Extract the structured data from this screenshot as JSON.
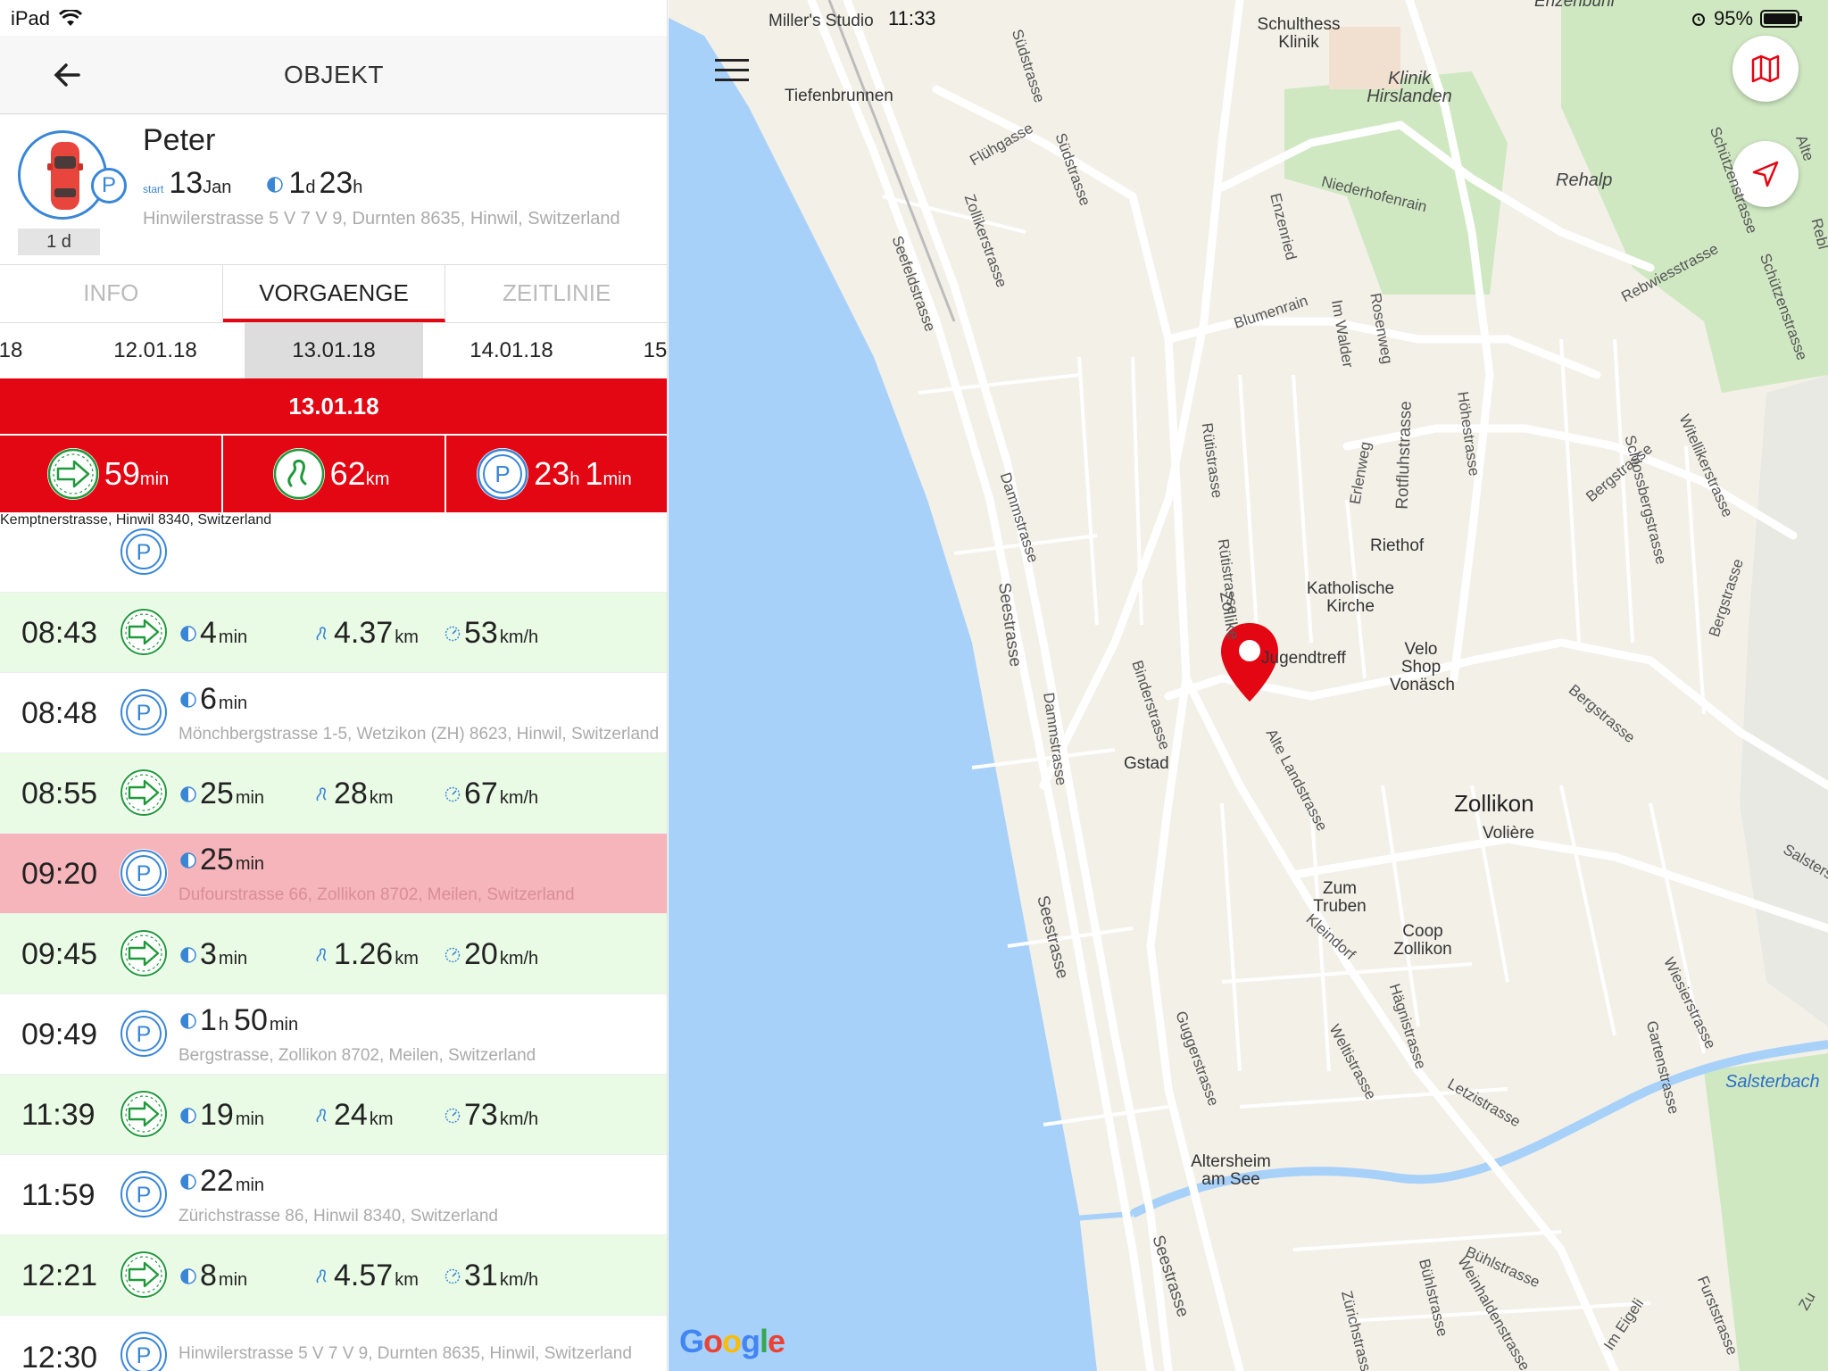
{
  "status_bar": {
    "device": "iPad",
    "time": "11:33",
    "battery": "95%"
  },
  "nav": {
    "title": "OBJEKT"
  },
  "object": {
    "name": "Peter",
    "start_label": "start",
    "start_day": "13",
    "start_month": "Jan",
    "duration_d": "1",
    "duration_d_unit": "d",
    "duration_h": "23",
    "duration_h_unit": "h",
    "address": "Hinwilerstrasse 5 V 7 V 9, Durnten 8635, Hinwil, Switzerland",
    "badge": "1 d"
  },
  "tabs": [
    {
      "label": "INFO"
    },
    {
      "label": "VORGAENGE"
    },
    {
      "label": "ZEITLINIE"
    }
  ],
  "dates": [
    "18",
    "12.01.18",
    "13.01.18",
    "14.01.18",
    "15"
  ],
  "day": {
    "title": "13.01.18",
    "drive_time": "59",
    "drive_time_unit": "min",
    "distance": "62",
    "distance_unit": "km",
    "park_h": "23",
    "park_h_unit": "h",
    "park_min": "1",
    "park_min_unit": "min"
  },
  "timeline": {
    "first": {
      "address": "Kemptnerstrasse, Hinwil 8340, Switzerland"
    },
    "rows": [
      {
        "time": "08:43",
        "dur": "4",
        "dur_unit": "min",
        "dist": "4.37",
        "dist_unit": "km",
        "speed": "53",
        "speed_unit": "km/h"
      },
      {
        "time": "08:48",
        "dur": "6",
        "dur_unit": "min",
        "address": "Mönchbergstrasse 1-5, Wetzikon (ZH) 8623, Hinwil, Switzerland"
      },
      {
        "time": "08:55",
        "dur": "25",
        "dur_unit": "min",
        "dist": "28",
        "dist_unit": "km",
        "speed": "67",
        "speed_unit": "km/h"
      },
      {
        "time": "09:20",
        "dur": "25",
        "dur_unit": "min",
        "address": "Dufourstrasse 66, Zollikon 8702, Meilen, Switzerland"
      },
      {
        "time": "09:45",
        "dur": "3",
        "dur_unit": "min",
        "dist": "1.26",
        "dist_unit": "km",
        "speed": "20",
        "speed_unit": "km/h"
      },
      {
        "time": "09:49",
        "dur_h": "1",
        "dur_h_unit": "h",
        "dur": "50",
        "dur_unit": "min",
        "address": "Bergstrasse, Zollikon 8702, Meilen, Switzerland"
      },
      {
        "time": "11:39",
        "dur": "19",
        "dur_unit": "min",
        "dist": "24",
        "dist_unit": "km",
        "speed": "73",
        "speed_unit": "km/h"
      },
      {
        "time": "11:59",
        "dur": "22",
        "dur_unit": "min",
        "address": "Zürichstrasse 86, Hinwil 8340, Switzerland"
      },
      {
        "time": "12:21",
        "dur": "8",
        "dur_unit": "min",
        "dist": "4.57",
        "dist_unit": "km",
        "speed": "31",
        "speed_unit": "km/h"
      },
      {
        "time": "12:30",
        "address": "Hinwilerstrasse 5 V 7 V 9, Durnten 8635, Hinwil, Switzerland"
      }
    ]
  },
  "map": {
    "labels": {
      "millers": "Miller's Studio",
      "tiefenbrunnen": "Tiefenbrunnen",
      "schulthess": "Schulthess Klinik",
      "hirslanden": "Klinik Hirslanden",
      "rehalp": "Rehalp",
      "enzenbuhl": "Enzenbuhl",
      "riethof": "Riethof",
      "kirche": "Katholische Kirche",
      "jugendtreff": "Jugendtreff",
      "velo": "Velo Shop Vonäsch",
      "gstad": "Gstad",
      "zollikon": "Zollikon",
      "voliere": "Volière",
      "truben": "Zum Truben",
      "coop": "Coop Zollikon",
      "altersheim": "Altersheim am See",
      "salsterbach": "Salsterbach",
      "google": "Google"
    },
    "streets": {
      "zollikerstrasse": "Zollikerstrasse",
      "seefeldstrasse": "Seefeldstrasse",
      "dammstrasse": "Dammstrasse",
      "seestrasse": "Seestrasse",
      "seestrasse2": "Seestrasse",
      "seestrasse3": "Seestrasse",
      "dammstrasse2": "Dammstrasse",
      "sudstrasse": "Südstrasse",
      "sudstrasse2": "Südstrasse",
      "fluhgasse": "Flühgasse",
      "blumenrain": "Blumenrain",
      "rutistrasse": "Rütistrasse",
      "rutistrasse2": "Rütistrasse",
      "rotfluhstrasse": "Rotfluhstrasse",
      "hohestrasse": "Höhestrasse",
      "bergstrasse": "Bergstrasse",
      "bergstrasse2": "Bergstrasse",
      "bergstrasse3": "Bergstrasse",
      "binderstrasse": "Binderstrasse",
      "altelandstrasse": "Alte Landstrasse",
      "guggerstrasse": "Guggerstrasse",
      "weltistrasse": "Weltistrasse",
      "hagnistrasse": "Hägnistrasse",
      "kleindorf": "Kleindorf",
      "letzistrasse": "Letzistrasse",
      "gartenstrasse": "Gartenstrasse",
      "wiesierstrasse": "Wiesierstrasse",
      "schlossberg": "Schlossbergstrasse",
      "witellikerstrasse": "Witellikerstrasse",
      "rebwiesstrasse": "Rebwiesstrasse",
      "schuetzenstrasse": "Schützenstrasse",
      "schuetzenstrasse2": "Schützenstrasse",
      "buhlstrasse": "Bühlstrasse",
      "buhlstrasse2": "Bühlstrasse",
      "weinhalden": "Weinhaldenstrasse",
      "zurichstrasse": "Zürichstrasse",
      "niederhofenrain": "Niederhofenrain",
      "enzenried": "Enzenried",
      "imwalder": "Im Walder",
      "rosenweg": "Rosenweg",
      "erlenweg": "Erlenweg",
      "zollikon_street": "Zollike",
      "furststrasse": "Furststrasse",
      "imeigeli": "Im Eigeli",
      "salsters": "Salsters",
      "alte": "Alte",
      "zu": "Zu",
      "rebl": "Rebl"
    }
  },
  "colors": {
    "accent": "#e30613",
    "park_blue": "#3a86d6",
    "drive_green": "#1f9a3a",
    "drive_bg": "#e9fbe5",
    "alert_bg": "#f5b5bb",
    "water": "#a8d1fa"
  },
  "icons": [
    "back-arrow-icon",
    "wifi-icon",
    "car-icon",
    "parking-icon",
    "drive-arrow-icon",
    "route-icon",
    "clock-icon",
    "speed-icon",
    "hamburger-icon",
    "map-layers-icon",
    "location-arrow-icon",
    "map-pin-icon",
    "alarm-icon",
    "battery-icon"
  ]
}
